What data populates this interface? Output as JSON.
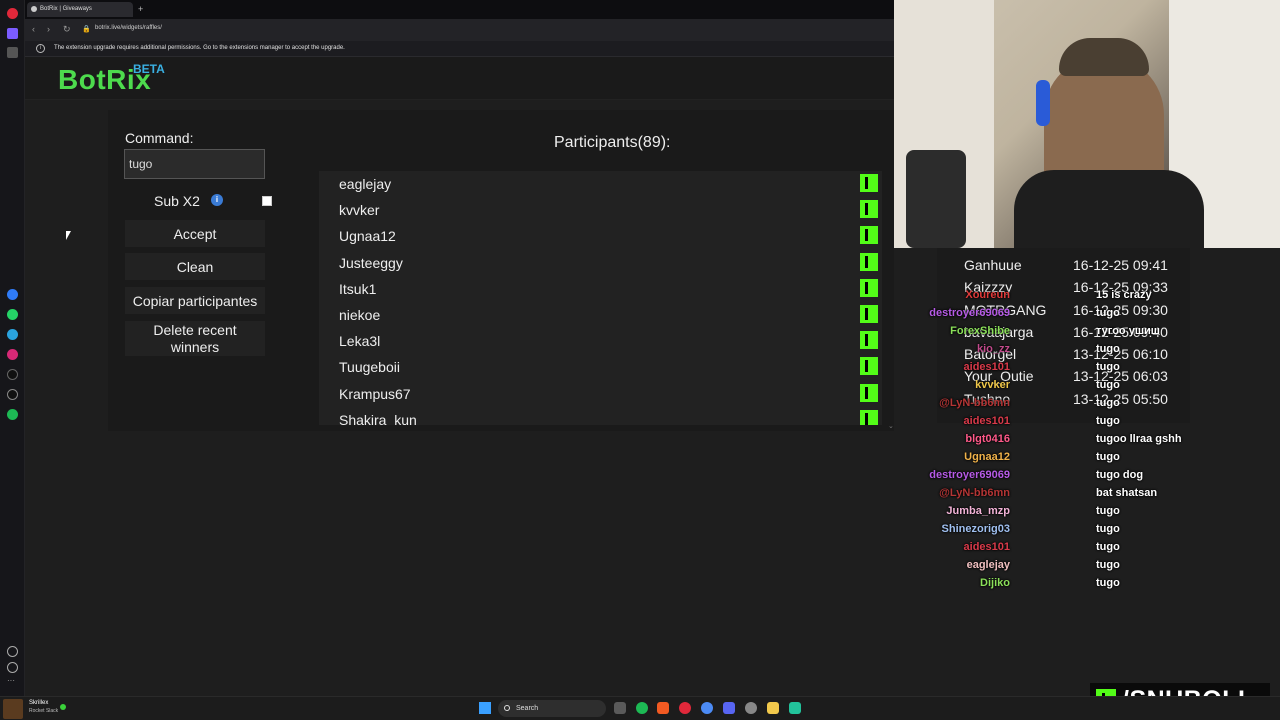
{
  "browser": {
    "tab_title": "BotRix | Giveaways",
    "new_tab": "+",
    "url": "botrix.live/widgets/raffles/",
    "info_message": "The extension upgrade requires additional permissions. Go to the extensions manager to accept the upgrade."
  },
  "app": {
    "logo": "BotRix",
    "beta": "BETA"
  },
  "form": {
    "command_label": "Command:",
    "command_value": "tugo",
    "sub_label": "Sub X2",
    "sub_checked": true,
    "accept_label": "Accept",
    "clean_label": "Clean",
    "copy_label": "Copiar participantes",
    "delete_label": "Delete recent winners"
  },
  "participants": {
    "title": "Participants(89):",
    "items": [
      "eaglejay",
      "kvvker",
      "Ugnaa12",
      "Justeeggy",
      "Itsuk1",
      "niekoe",
      "Leka3l",
      "Tuugeboii",
      "Krampus67",
      "Shakira_kun"
    ]
  },
  "winners": [
    {
      "name": "Ganhuue",
      "date": "16-12-25 09:41"
    },
    {
      "name": "Kaizzzy",
      "date": "16-12-25 09:33"
    },
    {
      "name": "MOTRGANG",
      "date": "16-12-25 09:30"
    },
    {
      "name": "bavaajarga",
      "date": "16-12-25 09:40"
    },
    {
      "name": "Batorgel",
      "date": "13-12-25 06:10"
    },
    {
      "name": "Your_Outie",
      "date": "13-12-25 06:03"
    },
    {
      "name": "Tushno",
      "date": "13-12-25 05:50"
    }
  ],
  "chat": [
    {
      "user": "Xoureun",
      "msg": "15 is crazy",
      "color": "#e03a3a"
    },
    {
      "user": "destroyer69069",
      "msg": "tugo",
      "color": "#b65be6"
    },
    {
      "user": "ForexShibe",
      "msg": "тугоо ушиш",
      "color": "#8be05a"
    },
    {
      "user": "kio_zz",
      "msg": "tugo",
      "color": "#c24a8c"
    },
    {
      "user": "aides101",
      "msg": "tugo",
      "color": "#d93a4a"
    },
    {
      "user": "kvvker",
      "msg": "tugo",
      "color": "#f0c84a"
    },
    {
      "user": "@LyN-bb6mn",
      "msg": "tugo",
      "color": "#b43535"
    },
    {
      "user": "aides101",
      "msg": "tugo",
      "color": "#d93a4a"
    },
    {
      "user": "blgt0416",
      "msg": "tugoo llraa gshh",
      "color": "#ff5a8a"
    },
    {
      "user": "Ugnaa12",
      "msg": "tugo",
      "color": "#f0b24a"
    },
    {
      "user": "destroyer69069",
      "msg": "tugo dog",
      "color": "#b65be6"
    },
    {
      "user": "@LyN-bb6mn",
      "msg": "bat shatsan",
      "color": "#b43535"
    },
    {
      "user": "Jumba_mzp",
      "msg": "tugo",
      "color": "#f3b4d8"
    },
    {
      "user": "Shinezorig03",
      "msg": "tugo",
      "color": "#a0c0f0"
    },
    {
      "user": "aides101",
      "msg": "tugo",
      "color": "#d93a4a"
    },
    {
      "user": "eaglejay",
      "msg": "tugo",
      "color": "#f0c0c0"
    },
    {
      "user": "Dijiko",
      "msg": "tugo",
      "color": "#8be05a"
    }
  ],
  "branding": {
    "handle": "/SNUBOLI"
  },
  "taskbar": {
    "app_title": "Skrillex",
    "app_sub": "Rocket Slack",
    "search_placeholder": "Search"
  },
  "colors": {
    "kick_green": "#53fc18",
    "botrix_green": "#4ddb4d",
    "beta_blue": "#3ab0e2"
  }
}
